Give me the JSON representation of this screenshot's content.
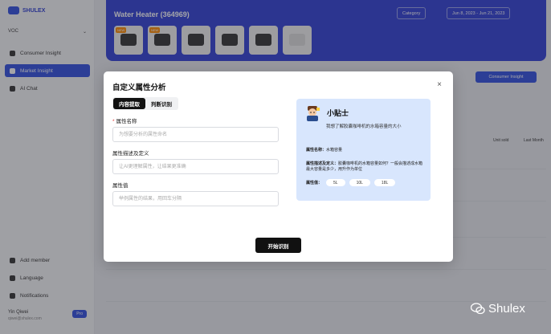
{
  "sidebar": {
    "logo": "SHULEX",
    "workspace": "VOC",
    "items": [
      {
        "label": "Consumer Insight"
      },
      {
        "label": "Market Insight"
      },
      {
        "label": "AI Chat"
      }
    ],
    "bottom": [
      {
        "label": "Add member"
      },
      {
        "label": "Language"
      },
      {
        "label": "Notifications"
      }
    ],
    "user": {
      "name": "Yin Qiwei",
      "email": "qiwei@shulex.com",
      "badge": "Pro"
    }
  },
  "header": {
    "title": "Water Heater (364969)",
    "chip_1": "Category",
    "chip_2": "Jun 8, 2023 - Jun 21, 2023",
    "thumb_tag": "NEW"
  },
  "main": {
    "action_button": "Consumer Insight",
    "col_1": "Unit sold",
    "col_2": "Last Month"
  },
  "modal": {
    "title": "自定义属性分析",
    "tabs": [
      {
        "label": "内容提取",
        "active": true
      },
      {
        "label": "判断识别",
        "active": false
      }
    ],
    "fields": {
      "name_label": "属性名称",
      "name_placeholder": "为想要分析的属性命名",
      "desc_label": "属性描述及定义",
      "desc_placeholder": "让AI更理解属性，让结果更准确",
      "value_label": "属性值",
      "value_placeholder": "举例属性的结果，用回车分隔"
    },
    "tips": {
      "title": "小贴士",
      "subtitle": "我想了解胶囊咖啡机的水箱容量的大小",
      "name_key": "属性名称：",
      "name_val": "水箱容量",
      "desc_key": "属性描述及定义：",
      "desc_val": "胶囊咖啡机的水箱容量如何？一般会描述成水箱最大容量是多少，用升作为单位",
      "values_key": "属性值：",
      "values": [
        "5L",
        "10L",
        "18L"
      ]
    },
    "submit": "开始识别"
  },
  "watermark": "Shulex"
}
